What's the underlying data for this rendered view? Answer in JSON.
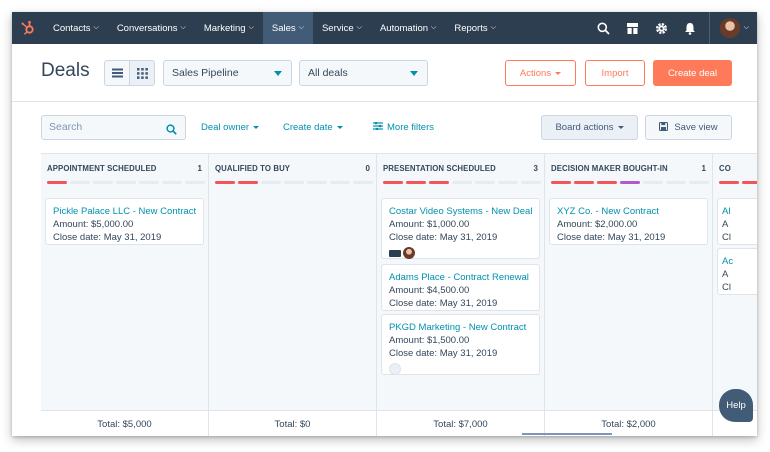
{
  "nav": {
    "items": [
      {
        "label": "Contacts"
      },
      {
        "label": "Conversations"
      },
      {
        "label": "Marketing"
      },
      {
        "label": "Sales"
      },
      {
        "label": "Service"
      },
      {
        "label": "Automation"
      },
      {
        "label": "Reports"
      }
    ],
    "active": "Sales"
  },
  "header": {
    "title": "Deals",
    "pipeline_select": "Sales Pipeline",
    "view_select": "All deals",
    "actions_label": "Actions",
    "import_label": "Import",
    "create_label": "Create deal"
  },
  "filters": {
    "search_placeholder": "Search",
    "deal_owner": "Deal owner",
    "create_date": "Create date",
    "more_filters": "More filters",
    "board_actions": "Board actions",
    "save_view": "Save view"
  },
  "columns": [
    {
      "title": "APPOINTMENT SCHEDULED",
      "count": "1",
      "filled": 1,
      "total": "Total: $5,000",
      "cards": [
        {
          "title": "Pickle Palace LLC - New Contract",
          "amount": "Amount: $5,000.00",
          "close": "Close date: May 31, 2019"
        }
      ]
    },
    {
      "title": "QUALIFIED TO BUY",
      "count": "0",
      "filled": 2,
      "total": "Total: $0",
      "cards": []
    },
    {
      "title": "PRESENTATION SCHEDULED",
      "count": "3",
      "filled": 3,
      "total": "Total: $7,000",
      "cards": [
        {
          "title": "Costar Video Systems - New Deal",
          "amount": "Amount: $1,000.00",
          "close": "Close date: May 31, 2019"
        },
        {
          "title": "Adams Place - Contract Renewal",
          "amount": "Amount: $4,500.00",
          "close": "Close date: May 31, 2019"
        },
        {
          "title": "PKGD Marketing - New Contract",
          "amount": "Amount: $1,500.00",
          "close": "Close date: May 31, 2019"
        }
      ]
    },
    {
      "title": "DECISION MAKER BOUGHT-IN",
      "count": "1",
      "filled": 4,
      "total": "Total: $2,000",
      "cards": [
        {
          "title": "XYZ Co. - New Contract",
          "amount": "Amount: $2,000.00",
          "close": "Close date: May 31, 2019"
        }
      ]
    },
    {
      "title": "CO",
      "count": "",
      "filled": 5,
      "total": "",
      "cards": [
        {
          "title": "Al",
          "amount": "A",
          "close": "Cl"
        },
        {
          "title": "Ac",
          "amount": "A",
          "close": "Cl"
        }
      ]
    }
  ],
  "help_label": "Help",
  "colors": {
    "nav_bg": "#2d3e50",
    "accent": "#ff7a59",
    "link": "#0091ae",
    "stage_bar_red": "#f2545b",
    "stage_bar_purple": "#b05ad0"
  }
}
